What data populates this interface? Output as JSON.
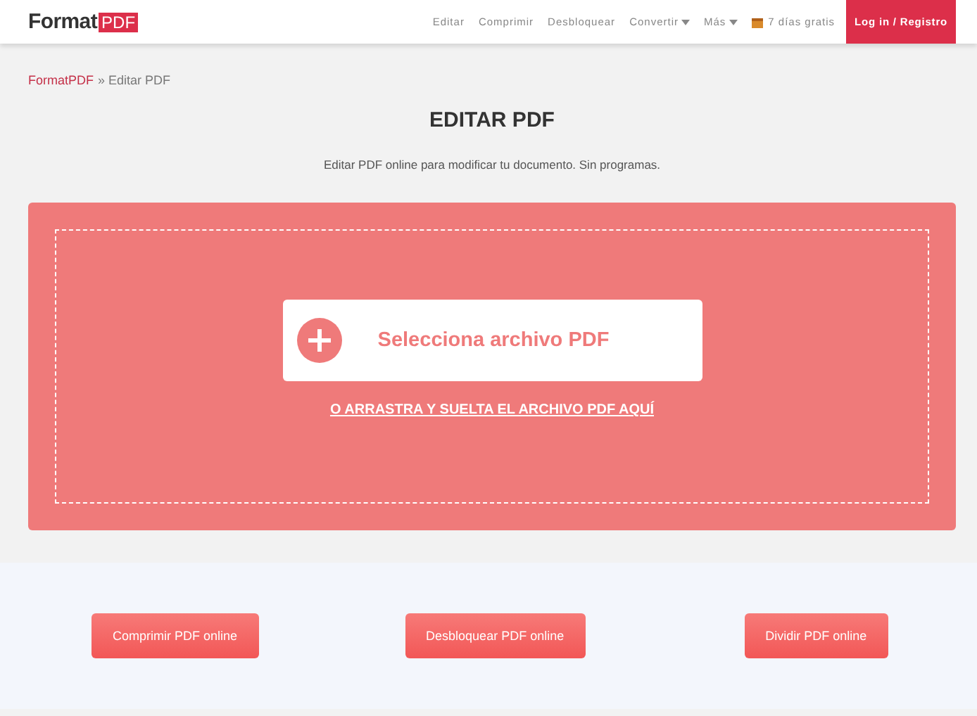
{
  "header": {
    "logo": {
      "text": "Format",
      "badge": "PDF"
    },
    "nav": [
      {
        "label": "Editar",
        "dropdown": false
      },
      {
        "label": "Comprimir",
        "dropdown": false
      },
      {
        "label": "Desbloquear",
        "dropdown": false
      },
      {
        "label": "Convertir",
        "dropdown": true
      },
      {
        "label": "Más",
        "dropdown": true
      }
    ],
    "trial": "7 días gratis",
    "login": "Log in / Registro"
  },
  "breadcrumb": {
    "link": "FormatPDF",
    "separator": "»",
    "current": "Editar PDF"
  },
  "title": "EDITAR PDF",
  "subtitle": "Editar PDF online para modificar tu documento. Sin programas.",
  "upload": {
    "button": "Selecciona archivo PDF",
    "drop_link": "O ARRASTRA Y SUELTA EL ARCHIVO PDF AQUÍ"
  },
  "tools": [
    "Comprimir PDF online",
    "Desbloquear PDF online",
    "Dividir PDF online"
  ]
}
